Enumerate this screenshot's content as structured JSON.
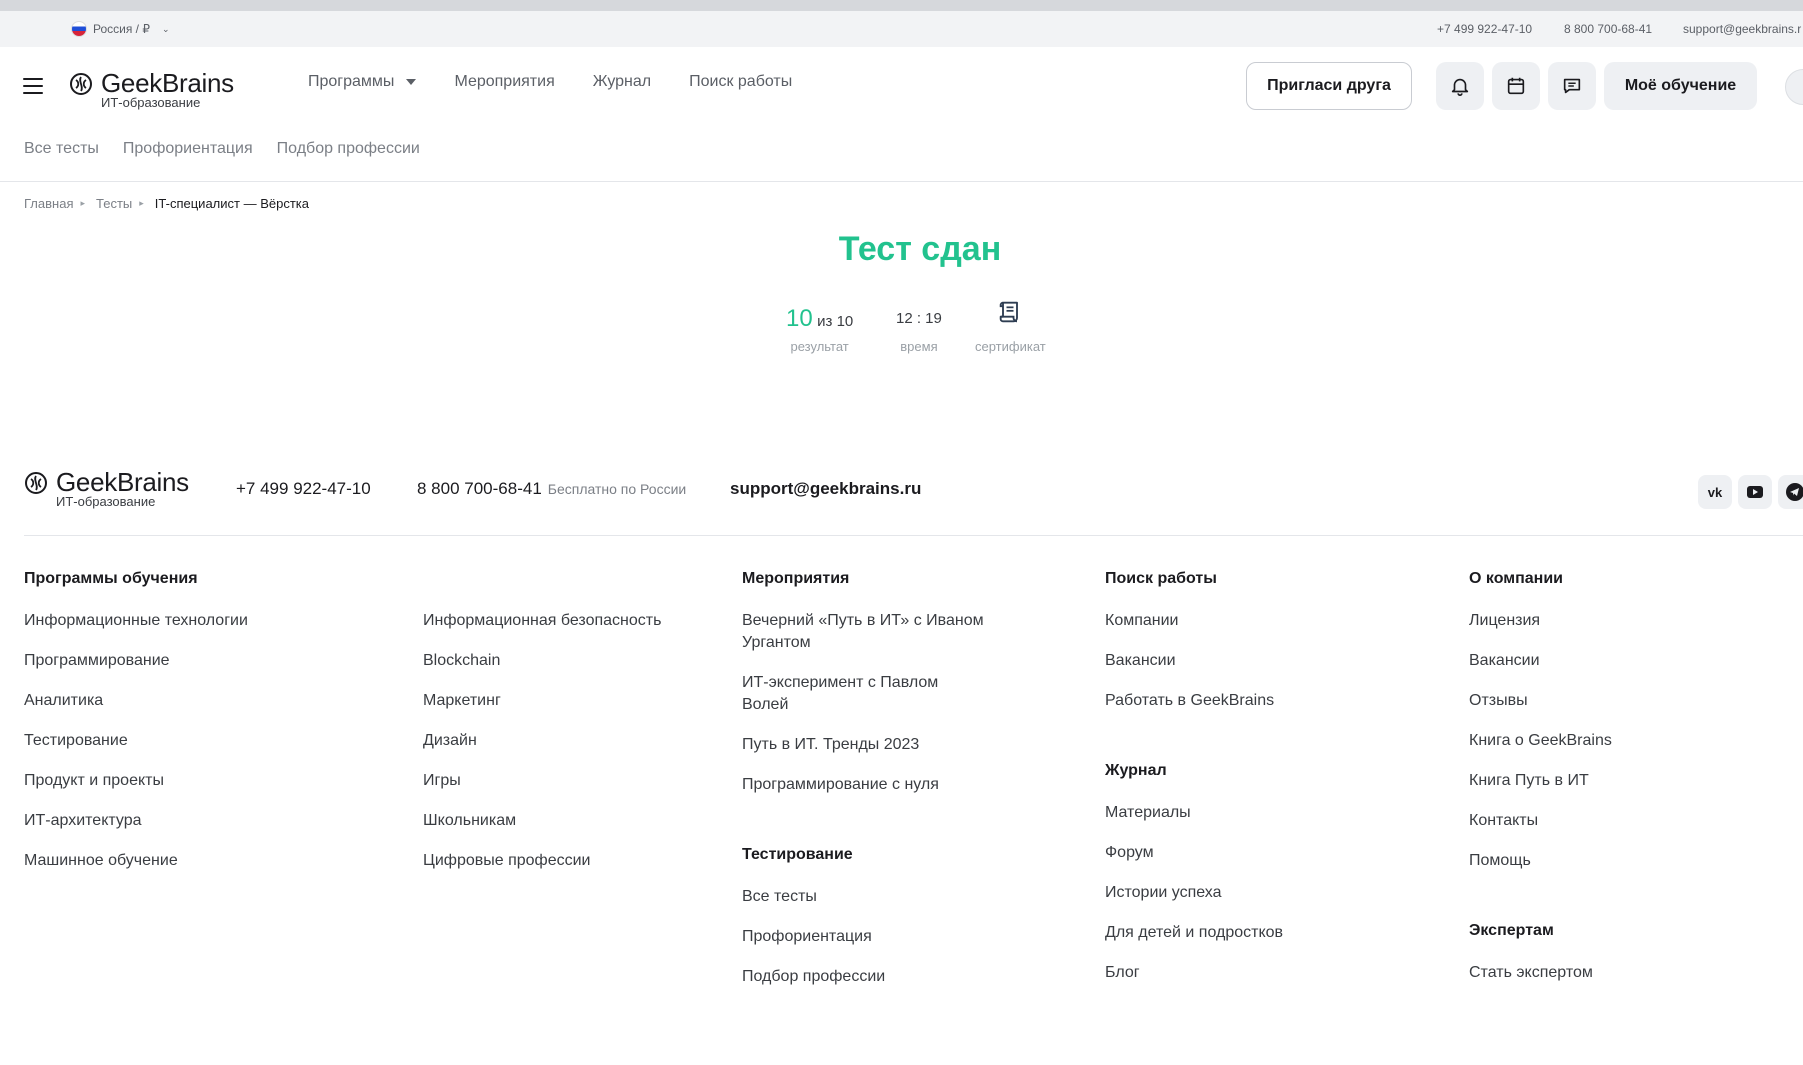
{
  "topbar": {
    "region": "Россия / ₽",
    "phone1": "+7 499 922-47-10",
    "phone2": "8 800 700-68-41",
    "email": "support@geekbrains.r"
  },
  "brand": {
    "name": "GeekBrains",
    "tagline": "ИТ-образование"
  },
  "nav": {
    "items": [
      "Программы",
      "Мероприятия",
      "Журнал",
      "Поиск работы"
    ]
  },
  "header": {
    "invite_label": "Пригласи друга",
    "learning_label": "Моё обучение"
  },
  "subnav": [
    "Все тесты",
    "Профориентация",
    "Подбор профессии"
  ],
  "breadcrumb": [
    "Главная",
    "Тесты",
    "IT-специалист — Вёрстка"
  ],
  "result": {
    "title": "Тест сдан",
    "score": "10",
    "score_total": "из 10",
    "score_label": "результат",
    "time": "12 : 19",
    "time_label": "время",
    "certificate_label": "сертификат"
  },
  "footer": {
    "phone1": "+7 499 922-47-10",
    "phone2": "8 800 700-68-41",
    "phone2_note": "Бесплатно по России",
    "email": "support@geekbrains.ru",
    "programs_title": "Программы обучения",
    "programs_col1": [
      "Информационные технологии",
      "Программирование",
      "Аналитика",
      "Тестирование",
      "Продукт и проекты",
      "ИТ-архитектура",
      "Машинное обучение"
    ],
    "programs_col2": [
      "Информационная безопасность",
      "Blockchain",
      "Маркетинг",
      "Дизайн",
      "Игры",
      "Школьникам",
      "Цифровые профессии"
    ],
    "events_title": "Мероприятия",
    "events": [
      "Вечерний «Путь в ИТ» с Иваном Ургантом",
      "ИТ-эксперимент с Павлом Волей",
      "Путь в ИТ. Тренды 2023",
      "Программирование с нуля"
    ],
    "testing_title": "Тестирование",
    "testing": [
      "Все тесты",
      "Профориентация",
      "Подбор профессии"
    ],
    "jobs_title": "Поиск работы",
    "jobs": [
      "Компании",
      "Вакансии",
      "Работать в GeekBrains"
    ],
    "journal_title": "Журнал",
    "journal": [
      "Материалы",
      "Форум",
      "Истории успеха",
      "Для детей и подростков",
      "Блог"
    ],
    "company_title": "О компании",
    "company": [
      "Лицензия",
      "Вакансии",
      "Отзывы",
      "Книга о GeekBrains",
      "Книга Путь в ИТ",
      "Контакты",
      "Помощь"
    ],
    "experts_title": "Экспертам",
    "experts": [
      "Стать экспертом"
    ]
  },
  "colors": {
    "accent": "#22c28e",
    "text": "#1b1b1f",
    "muted": "#7b7f86"
  }
}
